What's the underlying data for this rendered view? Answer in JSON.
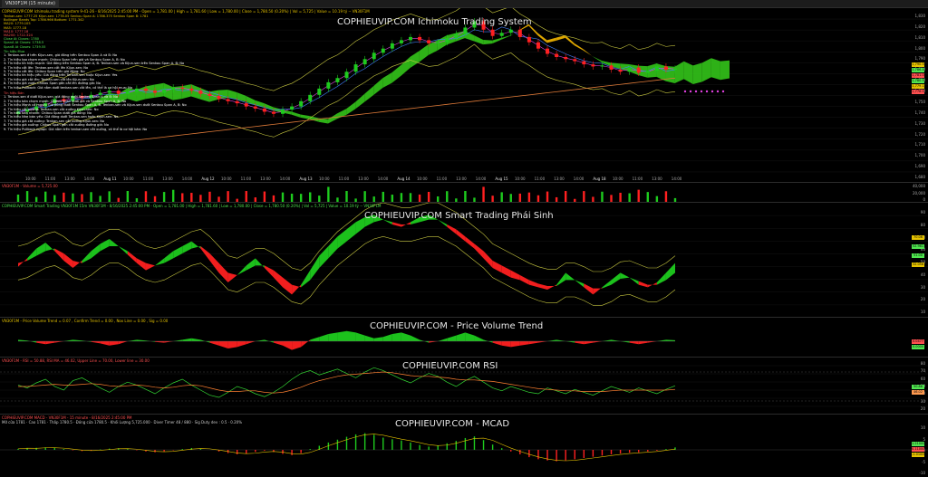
{
  "window": {
    "tab_label": "VN30F1M (15 minute)"
  },
  "main": {
    "title": "COPHIEUVIP.COM Ichimoku Trading System",
    "header": "COPHIEUVIP.COM Ichimoku trading system 9-41-26 - 8/16/2025 2:45:00 PM - Open = 1,781.00 | High = 1,781.60 | Low = 1,780.00 | Close = 1,780.50 (0.20%) | Vol = 5,725 | Value = 10.19 tỷ -- VN30F1M",
    "indicators": [
      {
        "text": "Tenkan-sen: 1777.25  Kijun-sen: 1778.05  Senkou Span A: 1786.375  Senkou Span B: 1781",
        "color": "#e6c300"
      },
      {
        "text": "Bollinger Bands Top: 1786.966  Bottom: 1771.342",
        "color": "#e6c300"
      },
      {
        "text": "MA20: 1779.105",
        "color": "#e6c300"
      },
      {
        "text": "MA5: 1777.18",
        "color": "#e6c300"
      },
      {
        "text": "MA10: 1777.18",
        "color": "#ff5050"
      },
      {
        "text": "MA200: 1722.324",
        "color": "#ff5050"
      },
      {
        "text": "Close At Closes: 1780",
        "color": "#50e650"
      },
      {
        "text": "SpanA At Closes: 1738.5",
        "color": "#50e650"
      },
      {
        "text": "SpanB At Closes: 1739.55",
        "color": "#50e650"
      }
    ],
    "signal_buy_header": "Tín hiệu Mua",
    "signals_buy": [
      "1. Tenkan-sen ở trên Kijun-sen, giá đóng trên Senkou Span A và B: No",
      "2. Tín hiệu tạo chạm mạnh: Chikou Span trên giá và Senkou Span A, B: No",
      "3. Tín hiệu tín hiệu mạnh: Giá đóng trên Senkou Span A, B. Tenkan-sen và Kijun-sen trên Senkou Span A, B: No",
      "4. Tín hiệu cắt lên: Tenkan-sen cắt lên Kijun-sen: No",
      "5. Tín hiệu cắt lên: Chikou Span trên giá đóng: No",
      "6. Tín hiệu tín hiệu yếu: Giá đóng trên Tenkan-sen hoặc Kijun-sen: Yes",
      "7. Tín hiệu giá cắt lên: Tenkan-sen cắt lên Kijun-sen: No",
      "8. Tín hiệu giá vượt: Chikou Span gần cắt lên đường giá: No",
      "9. Tín hiệu Pullback: Giá nằm dưới tenkan-sen cắt lên, có thể là cơ hội mua: No"
    ],
    "signal_sell_header": "Tín hiệu Bán",
    "signals_sell": [
      "1. Tenkan-sen ở dưới Kijun-sen, giá đóng dưới Senkou Span A và B: No",
      "2. Tín hiệu bán chạm mạnh: Chikou Span dưới giá và Senkou Span A, B: No",
      "3. Tín hiệu Mạnh cả mạnh: Giá đóng dưới Senkou Span A, B. Tenkan-sen và Kijun-sen dưới Senkou Span A, B: No",
      "4. Tín hiệu cắt xuống: Tenkan-sen cắt xuống Kijun-sen: No",
      "5. Tín hiệu bán nhanh: Chikou Span dưới giá đóng: No",
      "6. Tín hiệu Nhẹ bán yếu: Giá đóng dưới Tenkan-sen hoặc Kijun-sen: No",
      "7. Tín hiệu giá cắt xuống: Tenkan-sen cắt xuống Kijun-sen: No",
      "8. Tín hiệu giá xuống: Chikou Span gần cắt xuống đường giá: No",
      "9. Tín hiệu Pullback ngược: Giá nằm trên tenkan-sen cắt xuống, có thể là cơ hội bán: No"
    ],
    "y_ticks": [
      "1,830",
      "1,820",
      "1,810",
      "1,800",
      "1,790",
      "1,780",
      "1,770",
      "1,760",
      "1,750",
      "1,740",
      "1,730",
      "1,720",
      "1,710",
      "1,700",
      "1,690",
      "1,680"
    ],
    "x_ticks": [
      "10:00",
      "11:00",
      "13:00",
      "14:00",
      "Aug 11",
      "10:00",
      "11:00",
      "13:00",
      "14:00",
      "Aug 12",
      "10:00",
      "11:00",
      "13:00",
      "14:00",
      "Aug 13",
      "10:00",
      "11:00",
      "13:00",
      "14:00",
      "Aug 14",
      "10:00",
      "11:00",
      "13:00",
      "14:00",
      "Aug 15",
      "10:00",
      "11:00",
      "13:00",
      "14:00",
      "Aug 18",
      "10:00",
      "11:00",
      "13:00",
      "14:00"
    ],
    "price_boxes": [
      {
        "text": "1,790.5",
        "color": "#e6c300"
      },
      {
        "text": "1,786.4",
        "color": "#50e650"
      },
      {
        "text": "1,781.0",
        "color": "#ff5050"
      },
      {
        "text": "1,780.5",
        "color": "#50e650"
      },
      {
        "text": "1,779.1",
        "color": "#e6c300"
      },
      {
        "text": "1,778.0",
        "color": "#ff5050"
      }
    ]
  },
  "volume": {
    "header": "VN30F1M - Volume = 5,725.00",
    "y_ticks": [
      "40,000",
      "20,000",
      "0"
    ]
  },
  "smart": {
    "title": "COPHIEUVIP.COM Smart Trading Phái Sinh",
    "header": "COPHIEUVIP.COM Smart Trading VN30F1M 15m VN30F1M - 8/16/2025 2:45:00 PM - Open = 1,781.00 | High = 1,781.60 | Low = 1,780.00 | Close = 1,780.50 (0.20%) | Vol = 5,725 | Value = 10.19 tỷ -- VN30F1M",
    "y_ticks": [
      "90",
      "80",
      "70",
      "60",
      "50",
      "40",
      "30",
      "20",
      "10"
    ],
    "value_boxes": [
      {
        "text": "70.06",
        "color": "#e6c300"
      },
      {
        "text": "52.961",
        "color": "#50e650"
      },
      {
        "text": "51.00",
        "color": "#50e650"
      },
      {
        "text": "32.058",
        "color": "#e6c300"
      }
    ]
  },
  "pvt": {
    "title": "COPHIEUVIP.COM - Price Volume Trend",
    "header": "VN30F1M - Price Volume Trend = 0.07 , Confirm Trend = 0.00 , Nox Line = 0.00 , Sig = 0.00",
    "value_boxes": [
      {
        "text": "0.0477",
        "color": "#ff5050"
      },
      {
        "text": "0.0000",
        "color": "#50e650"
      }
    ]
  },
  "rsi": {
    "title": "COPHIEUVIP.COM RSI",
    "header": "VN30F1M - RSI = 50.88, RSI MA = 46.02, Upper Line = 70.00, Lower line = 30.00",
    "y_ticks": [
      "80",
      "70",
      "60",
      "50",
      "40",
      "30",
      "20"
    ],
    "value_boxes": [
      {
        "text": "50.88",
        "color": "#50e650"
      },
      {
        "text": "46.02",
        "color": "#ff9a50"
      }
    ]
  },
  "macd": {
    "title": "COPHIEUVIP.COM - MCAD",
    "header": "COPHIEUVIP.COM MACD - VN30F1M - 15 minute - 8/16/2025 2:45:00 PM",
    "subheader": "Mở cửa 1781 · Cao 1781 · Thấp 1780.5 · Đóng cửa 1780.5 · Khối Lượng 5,725.000 · Diver Timer 48 / 880 · Sig Duty dev : 0.5 · 0.20%",
    "y_ticks": [
      "10",
      "5",
      "0",
      "-5",
      "-10"
    ],
    "value_boxes": [
      {
        "text": "1.210000",
        "color": "#50e650"
      },
      {
        "text": "0.110000",
        "color": "#ff5050"
      },
      {
        "text": "-1.01000",
        "color": "#e6c300"
      }
    ]
  },
  "colors": {
    "up": "#1ecb1e",
    "down": "#ff2020",
    "cloud_up": "#33c41a",
    "cloud_down": "#f5b800",
    "ma200": "#e07b39",
    "bb": "#c8c840",
    "tenkan": "#e040e0",
    "kijun": "#4080ff"
  },
  "chart_data": [
    {
      "type": "candlestick",
      "title": "COPHIEUVIP.COM Ichimoku Trading System",
      "ylim": [
        1675,
        1835
      ],
      "close": [
        1740,
        1742,
        1745,
        1748,
        1752,
        1750,
        1755,
        1753,
        1756,
        1758,
        1760,
        1757,
        1759,
        1762,
        1760,
        1758,
        1761,
        1763,
        1762,
        1760,
        1757,
        1755,
        1752,
        1750,
        1748,
        1745,
        1743,
        1740,
        1738,
        1742,
        1745,
        1750,
        1756,
        1762,
        1768,
        1772,
        1778,
        1785,
        1790,
        1796,
        1800,
        1805,
        1808,
        1811,
        1808,
        1805,
        1806,
        1810,
        1814,
        1820,
        1826,
        1818,
        1812,
        1815,
        1818,
        1811,
        1806,
        1800,
        1795,
        1792,
        1790,
        1788,
        1785,
        1783,
        1784,
        1780,
        1778,
        1782,
        1777,
        1779,
        1783,
        1780,
        1781
      ],
      "ma200": [
        1700,
        1701,
        1702,
        1703,
        1704,
        1705,
        1706,
        1707,
        1708,
        1709,
        1710,
        1711,
        1712,
        1713,
        1714,
        1715,
        1716,
        1717,
        1718,
        1719,
        1720,
        1721,
        1722,
        1723,
        1724,
        1725,
        1726,
        1727,
        1728,
        1729,
        1730,
        1731,
        1732,
        1733,
        1734,
        1735,
        1736,
        1737,
        1738,
        1739,
        1740,
        1741,
        1742,
        1743,
        1744,
        1745,
        1746,
        1747,
        1748,
        1749,
        1750,
        1751,
        1752,
        1753,
        1754,
        1755,
        1756,
        1757,
        1758,
        1759,
        1760,
        1761,
        1762,
        1763,
        1764,
        1765,
        1766,
        1767,
        1768,
        1769,
        1770,
        1771,
        1772
      ]
    },
    {
      "type": "area",
      "title": "COPHIEUVIP.COM Smart Trading Phái Sinh",
      "ylim": [
        5,
        95
      ],
      "fast": [
        45,
        52,
        60,
        65,
        58,
        50,
        44,
        50,
        58,
        64,
        68,
        62,
        55,
        48,
        42,
        46,
        52,
        58,
        62,
        66,
        60,
        50,
        40,
        32,
        38,
        46,
        52,
        44,
        36,
        28,
        22,
        30,
        42,
        54,
        62,
        70,
        76,
        82,
        86,
        88,
        84,
        80,
        78,
        82,
        86,
        88,
        84,
        78,
        72,
        66,
        60,
        52,
        44,
        40,
        36,
        34,
        30,
        28,
        26,
        30,
        40,
        34,
        28,
        22,
        28,
        34,
        40,
        36,
        30,
        28,
        32,
        40,
        48
      ],
      "slow": [
        48,
        50,
        54,
        58,
        60,
        56,
        50,
        48,
        52,
        58,
        62,
        62,
        58,
        52,
        48,
        46,
        48,
        52,
        56,
        60,
        62,
        56,
        48,
        40,
        38,
        42,
        46,
        46,
        42,
        36,
        30,
        28,
        34,
        44,
        52,
        60,
        66,
        72,
        78,
        82,
        84,
        82,
        80,
        80,
        82,
        84,
        84,
        80,
        76,
        70,
        64,
        58,
        50,
        46,
        42,
        38,
        34,
        31,
        29,
        29,
        34,
        34,
        31,
        27,
        27,
        30,
        35,
        36,
        33,
        30,
        30,
        34,
        40
      ]
    },
    {
      "type": "area",
      "title": "COPHIEUVIP.COM - Price Volume Trend",
      "ylim": [
        -1,
        1
      ],
      "values": [
        0.1,
        0.05,
        -0.1,
        -0.2,
        -0.1,
        0.0,
        0.1,
        0.05,
        -0.05,
        -0.15,
        -0.3,
        -0.2,
        0.0,
        0.1,
        0.05,
        -0.05,
        -0.1,
        0.0,
        0.1,
        0.2,
        0.1,
        -0.1,
        -0.3,
        -0.5,
        -0.4,
        -0.2,
        0.0,
        0.1,
        -0.1,
        -0.3,
        -0.6,
        -0.4,
        0.1,
        0.3,
        0.5,
        0.6,
        0.7,
        0.6,
        0.4,
        0.2,
        0.3,
        0.5,
        0.6,
        0.4,
        0.1,
        -0.1,
        0.0,
        0.2,
        0.4,
        0.6,
        0.4,
        0.1,
        -0.1,
        -0.3,
        -0.4,
        -0.3,
        -0.2,
        -0.1,
        0.0,
        0.1,
        0.0,
        -0.1,
        -0.2,
        -0.1,
        0.0,
        0.1,
        0.0,
        -0.1,
        -0.2,
        -0.1,
        0.0,
        0.1,
        0.07
      ]
    },
    {
      "type": "line",
      "title": "COPHIEUVIP.COM RSI",
      "ylim": [
        15,
        85
      ],
      "rsi": [
        52,
        48,
        55,
        60,
        50,
        45,
        58,
        62,
        55,
        48,
        42,
        50,
        56,
        52,
        46,
        40,
        48,
        55,
        60,
        52,
        45,
        38,
        35,
        42,
        50,
        46,
        40,
        36,
        42,
        50,
        60,
        68,
        72,
        66,
        70,
        74,
        68,
        62,
        70,
        76,
        72,
        66,
        60,
        55,
        62,
        68,
        64,
        56,
        50,
        58,
        64,
        56,
        48,
        44,
        50,
        46,
        42,
        40,
        48,
        44,
        40,
        46,
        42,
        38,
        44,
        50,
        46,
        42,
        48,
        44,
        40,
        46,
        51
      ],
      "rsi_ma": [
        50,
        50,
        51,
        52,
        53,
        52,
        52,
        53,
        54,
        53,
        51,
        50,
        51,
        52,
        51,
        49,
        48,
        49,
        51,
        52,
        51,
        48,
        45,
        43,
        43,
        44,
        44,
        42,
        41,
        42,
        45,
        49,
        54,
        58,
        61,
        64,
        66,
        67,
        68,
        69,
        70,
        69,
        67,
        65,
        64,
        64,
        63,
        62,
        60,
        59,
        59,
        58,
        57,
        55,
        53,
        51,
        49,
        47,
        46,
        45,
        44,
        44,
        43,
        43,
        43,
        44,
        45,
        45,
        45,
        45,
        45,
        45,
        46
      ]
    },
    {
      "type": "bar",
      "title": "COPHIEUVIP.COM - MCAD",
      "ylim": [
        -12,
        12
      ],
      "values": [
        0.5,
        0.8,
        1,
        1.2,
        0.9,
        0.4,
        -0.2,
        -0.6,
        -0.3,
        0.2,
        0.6,
        0.8,
        0.4,
        -0.2,
        -0.8,
        -1.2,
        -0.8,
        -0.2,
        0.4,
        0.9,
        0.6,
        0,
        -0.8,
        -1.6,
        -2.2,
        -1.8,
        -1,
        -0.4,
        -1,
        -2,
        -2.6,
        -1.6,
        0.4,
        2,
        3.6,
        5,
        6.4,
        7.6,
        8.2,
        7.4,
        6,
        5.2,
        4.6,
        3.6,
        2.4,
        1.6,
        2.2,
        3.2,
        4.4,
        5.8,
        6.6,
        4.8,
        2.6,
        0.8,
        -0.8,
        -2.2,
        -3.6,
        -4.6,
        -5.2,
        -5.6,
        -5.2,
        -4.6,
        -4,
        -3.4,
        -2.8,
        -2.2,
        -1.8,
        -1.4,
        -1.2,
        -0.8,
        -0.4,
        0.4,
        1.2
      ]
    }
  ]
}
